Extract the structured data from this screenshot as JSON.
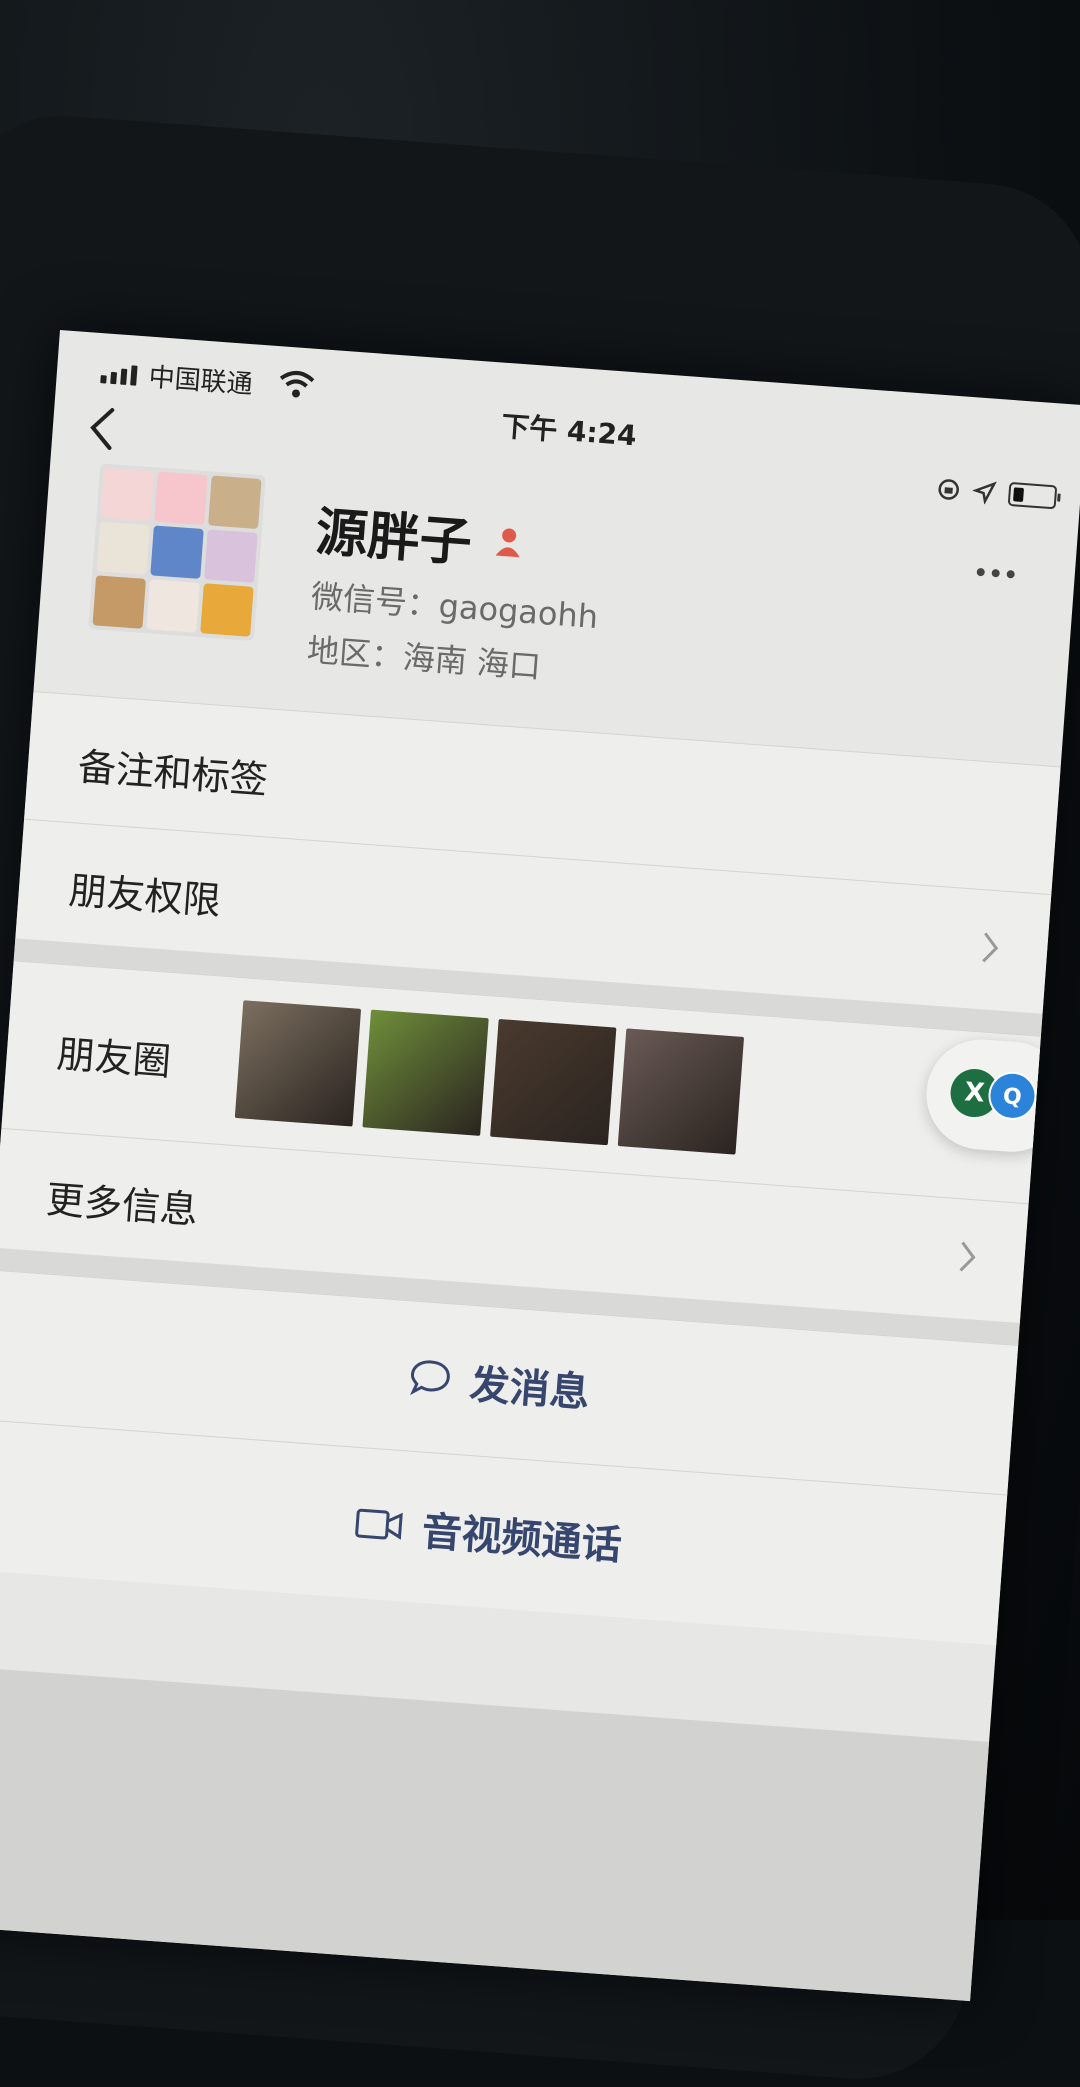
{
  "status_bar": {
    "carrier": "中国联通",
    "time": "下午 4:24",
    "icons": [
      "signal-icon",
      "wifi-icon",
      "rotation-lock-icon",
      "location-icon",
      "battery-icon"
    ]
  },
  "profile": {
    "name": "源胖子",
    "wechat_id": "微信号：gaogaohh",
    "region": "地区：海南 海口",
    "avatar_tiles": [
      "#f4d6d6",
      "#f6c6cc",
      "#c9b08a",
      "#e9e3d8",
      "#5f86c9",
      "#d9c2dc",
      "#c59a66",
      "#efe7df",
      "#e8a83a"
    ],
    "gender_color": "#e05a4b"
  },
  "menu": {
    "remark_tags": "备注和标签",
    "friend_permissions": "朋友权限",
    "moments": "朋友圈",
    "more_info": "更多信息"
  },
  "moments_photos": [
    "#7c6f5f",
    "#6f8f3a",
    "#4a3a2e",
    "#6a5a55"
  ],
  "actions": {
    "send_message": "发消息",
    "av_call": "音视频通话"
  },
  "floating_button": {
    "left_badge": "X",
    "right_badge": "Q"
  },
  "colors": {
    "action_text": "#36466e",
    "background": "#eeeeec"
  }
}
